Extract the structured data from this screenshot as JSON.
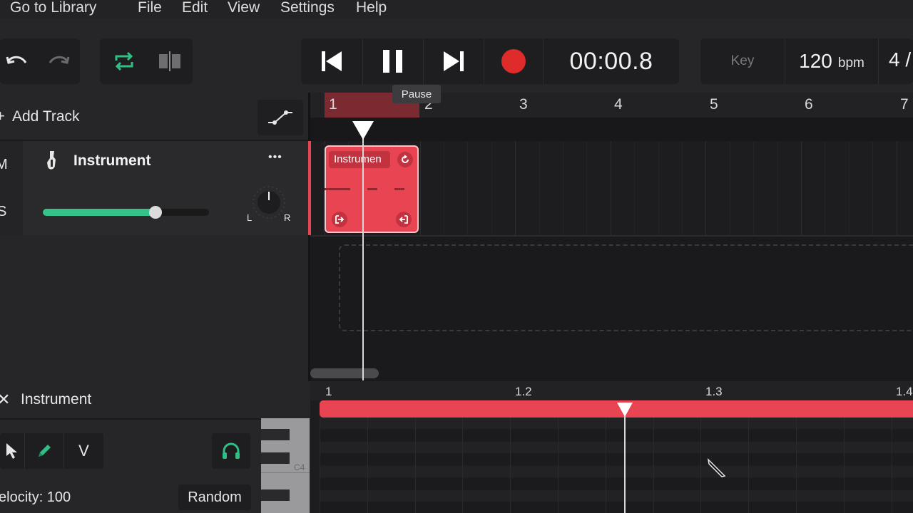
{
  "menu": {
    "library": "Go to Library",
    "file": "File",
    "edit": "Edit",
    "view": "View",
    "settings": "Settings",
    "help": "Help"
  },
  "transport": {
    "time": "00:00.8",
    "key_label": "Key",
    "tempo_value": "120",
    "tempo_unit": "bpm",
    "time_signature": "4 /",
    "pause_tooltip": "Pause",
    "record_color": "#e02b2b"
  },
  "tracks": {
    "add_track": "Add Track",
    "mute": "M",
    "solo": "S",
    "track_name": "Instrument",
    "more": "•••",
    "pan_left": "L",
    "pan_right": "R",
    "volume_level": 0.68,
    "accent": "#34c48b"
  },
  "ruler": [
    "1",
    "2",
    "3",
    "4",
    "5",
    "6",
    "7"
  ],
  "clip": {
    "label": "Instrumen",
    "color": "#e84452"
  },
  "editor": {
    "title": "Instrument",
    "tool_velocity": "V",
    "velocity_label": "elocity: 100",
    "random_button": "Random",
    "c4_label": "C4",
    "ruler": [
      "1",
      "1.2",
      "1.3",
      "1.4"
    ]
  },
  "colors": {
    "accent_green": "#2fbf84",
    "clip_red": "#e84452",
    "record": "#e02b2b"
  }
}
